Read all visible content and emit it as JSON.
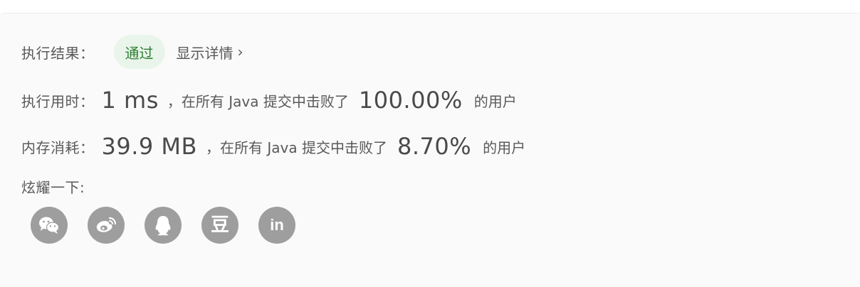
{
  "result": {
    "label": "执行结果：",
    "status": "通过",
    "details_link": "显示详情"
  },
  "runtime": {
    "label": "执行用时：",
    "value": "1 ms",
    "middle_text": "，在所有 Java 提交中击败了",
    "percent": "100.00%",
    "suffix": "的用户"
  },
  "memory": {
    "label": "内存消耗：",
    "value": "39.9 MB",
    "middle_text": "，在所有 Java 提交中击败了",
    "percent": "8.70%",
    "suffix": "的用户"
  },
  "share": {
    "label": "炫耀一下:",
    "icons": [
      "wechat-icon",
      "weibo-icon",
      "qq-icon",
      "douban-icon",
      "linkedin-icon"
    ],
    "douban_glyph": "豆",
    "linkedin_glyph": "in"
  },
  "colors": {
    "badge_bg": "#e9f5ea",
    "badge_text": "#2e7d32",
    "icon_bg": "#9e9e9e"
  }
}
